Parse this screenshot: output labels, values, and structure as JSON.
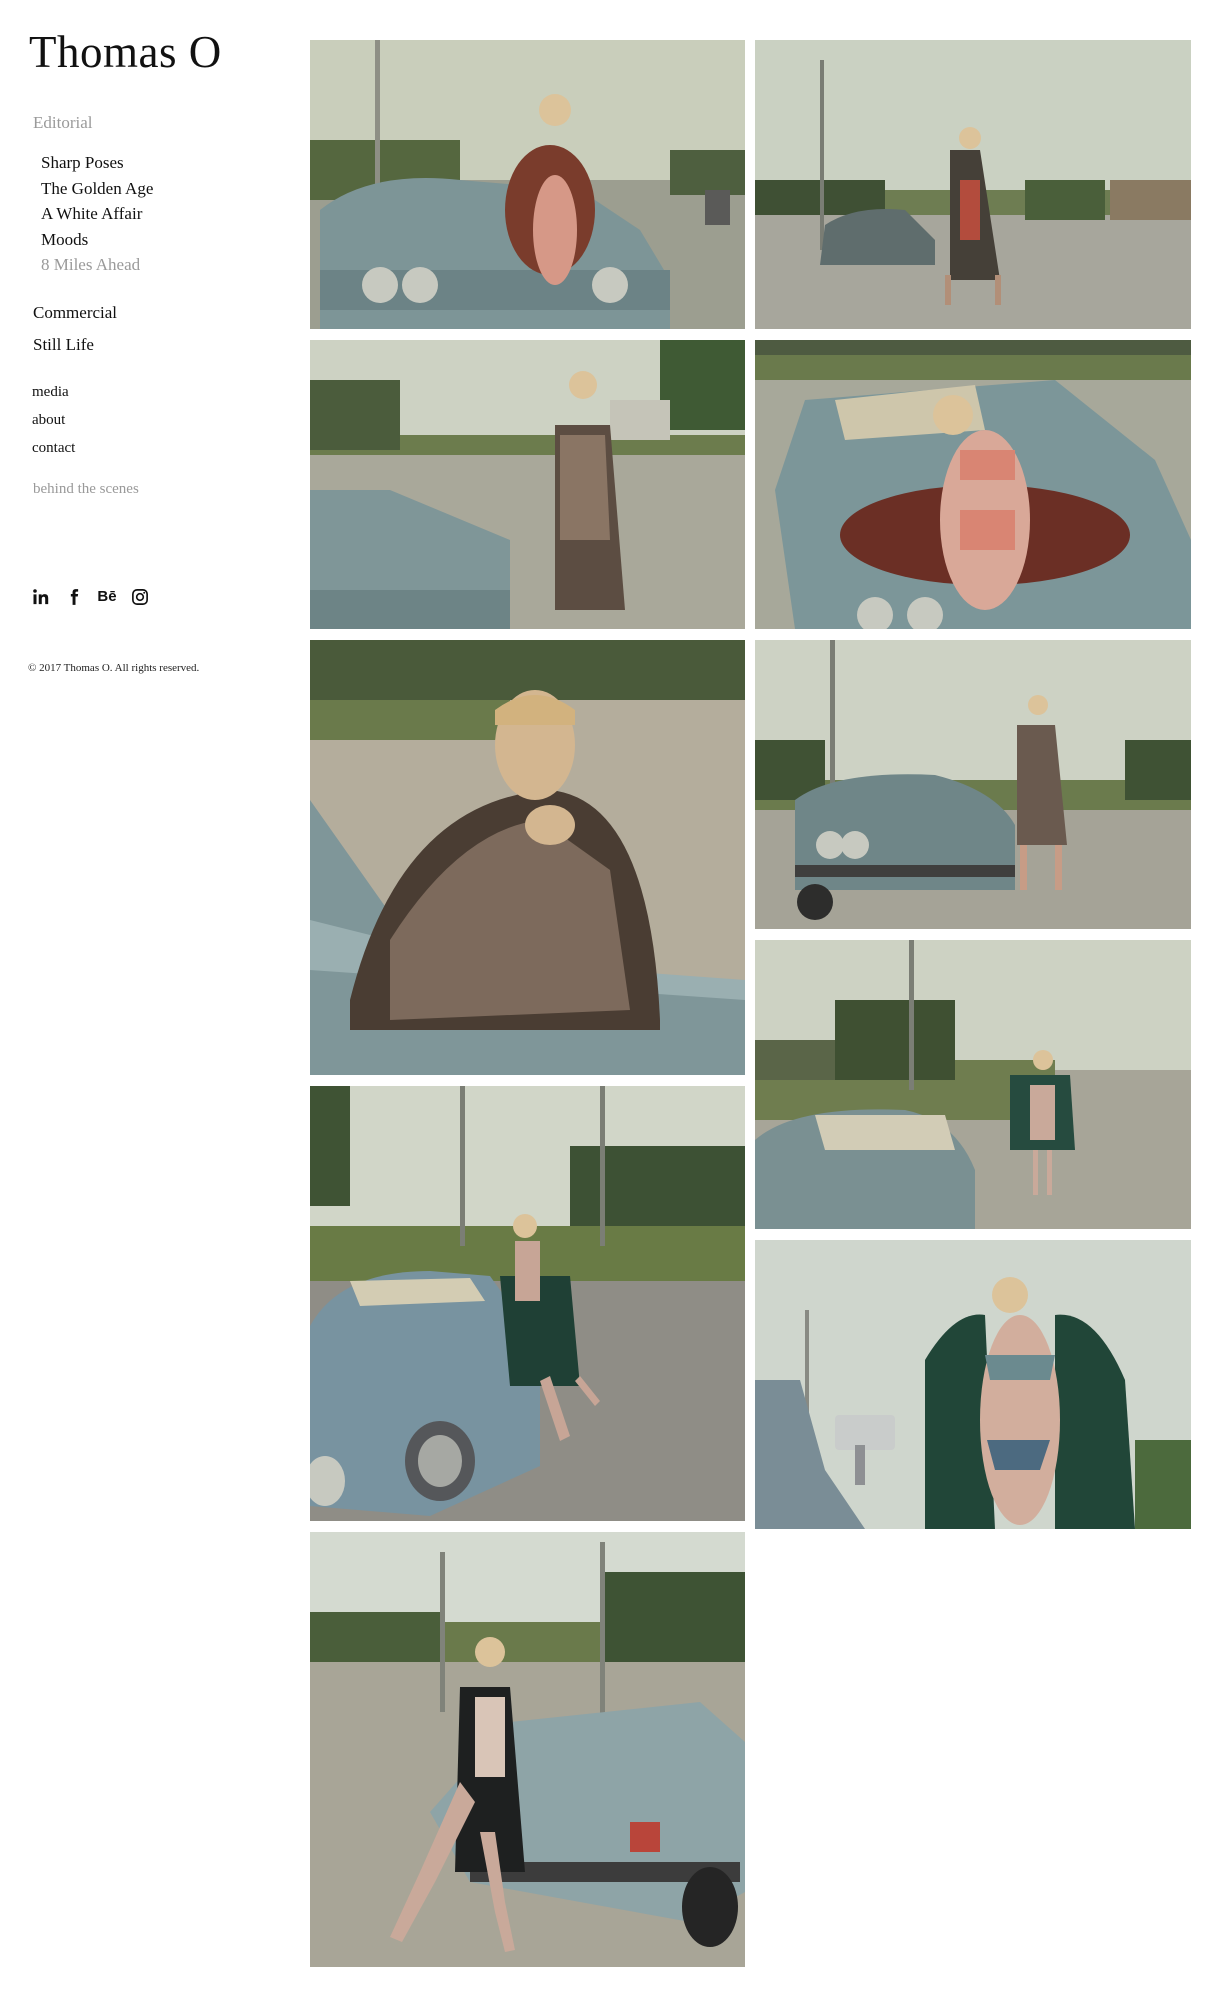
{
  "site": {
    "title": "Thomas O"
  },
  "nav": {
    "editorial_label": "Editorial",
    "editorial_items": [
      {
        "label": "Sharp Poses"
      },
      {
        "label": "The Golden Age"
      },
      {
        "label": "A White Affair"
      },
      {
        "label": "Moods"
      },
      {
        "label": "8 Miles Ahead",
        "active": true
      }
    ],
    "main_items": [
      {
        "label": "Commercial"
      },
      {
        "label": "Still Life"
      }
    ],
    "secondary_items": [
      {
        "label": "media"
      },
      {
        "label": "about"
      },
      {
        "label": "contact"
      }
    ],
    "behind_the_scenes": "behind the scenes"
  },
  "social": [
    {
      "name": "linkedin-icon"
    },
    {
      "name": "facebook-icon"
    },
    {
      "name": "behance-icon",
      "glyph": "Bē"
    },
    {
      "name": "instagram-icon"
    }
  ],
  "footer": {
    "copyright": "© 2017 Thomas O. All rights reserved."
  },
  "gallery": {
    "photos": [
      {
        "name": "photo-1"
      },
      {
        "name": "photo-2"
      },
      {
        "name": "photo-3"
      },
      {
        "name": "photo-4"
      },
      {
        "name": "photo-5"
      },
      {
        "name": "photo-6"
      },
      {
        "name": "photo-7"
      },
      {
        "name": "photo-8"
      },
      {
        "name": "photo-9"
      },
      {
        "name": "photo-10"
      }
    ]
  }
}
